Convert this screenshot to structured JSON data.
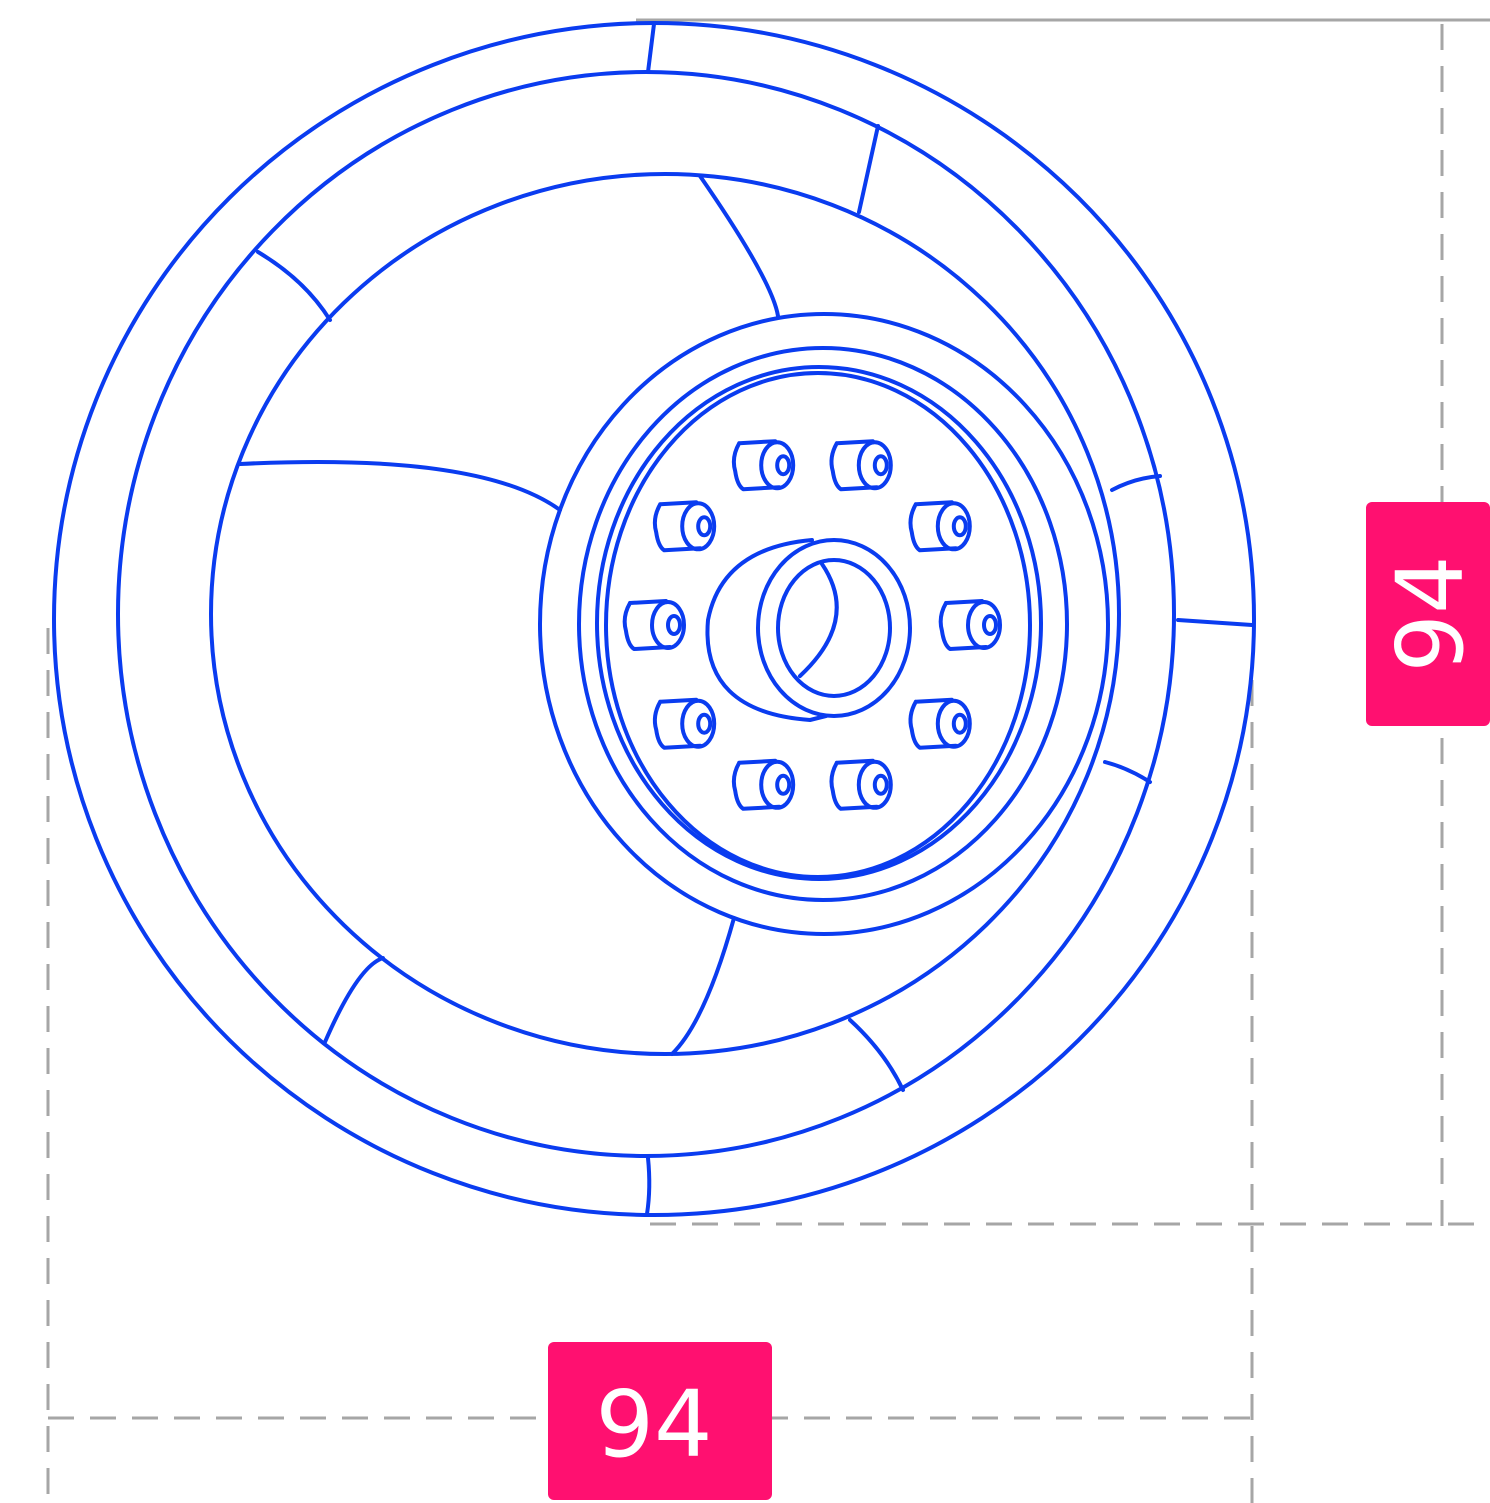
{
  "dimensions": {
    "width_label": "94",
    "height_label": "94"
  },
  "colors": {
    "stroke": "#0a3cf0",
    "badge": "#ff1070",
    "dimension_line": "#a6a6a6"
  },
  "drawing": {
    "subject": "wheel-icon",
    "lug_nut_count": 10
  }
}
